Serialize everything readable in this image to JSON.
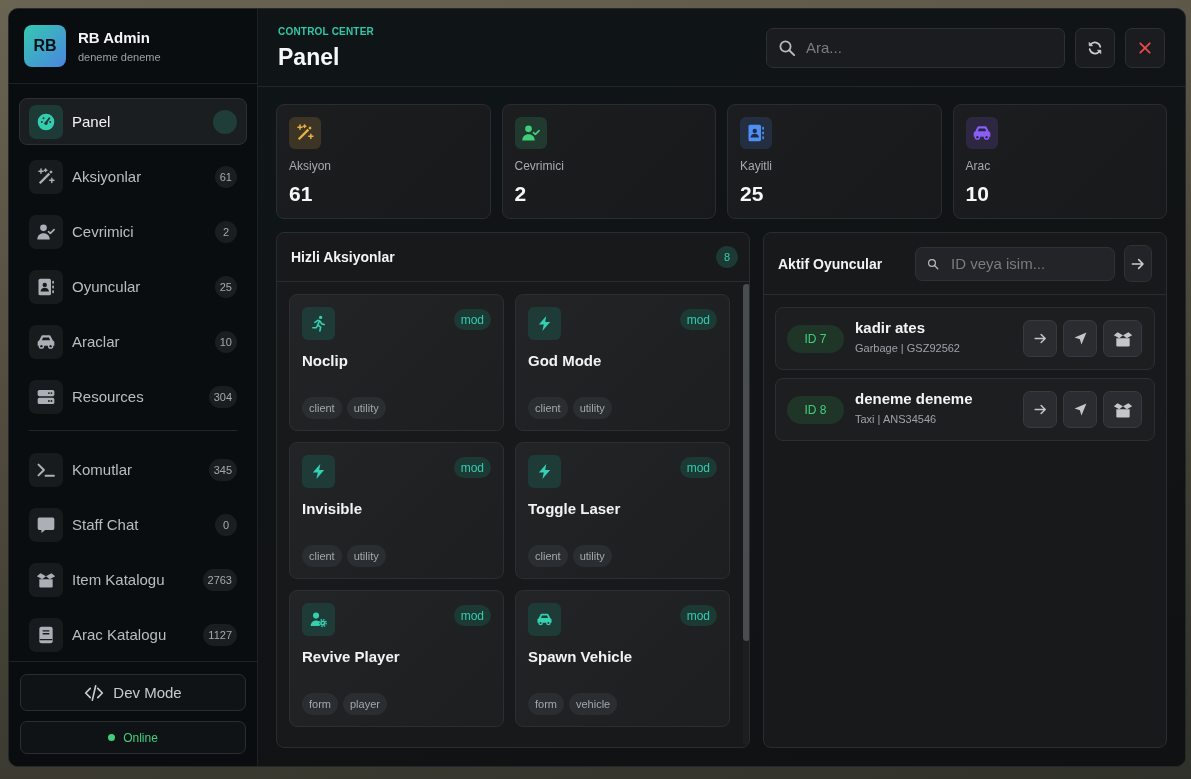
{
  "sidebar": {
    "avatar": "RB",
    "title": "RB Admin",
    "subtitle": "deneme deneme",
    "groups": [
      {
        "items": [
          {
            "label": "Panel",
            "selected": true
          },
          {
            "label": "Aksiyonlar",
            "count": "61",
            "selected": false
          },
          {
            "label": "Cevrimici",
            "count": "2",
            "selected": false
          },
          {
            "label": "Oyuncular",
            "count": "25",
            "selected": false
          },
          {
            "label": "Araclar",
            "count": "10",
            "selected": false
          },
          {
            "label": "Resources",
            "count": "304",
            "selected": false
          }
        ]
      },
      {
        "items": [
          {
            "label": "Komutlar",
            "count": "345",
            "selected": false
          },
          {
            "label": "Staff Chat",
            "count": "0",
            "selected": false
          },
          {
            "label": "Item Katalogu",
            "count": "2763",
            "selected": false
          },
          {
            "label": "Arac Katalogu",
            "count": "1127",
            "selected": false
          }
        ]
      }
    ],
    "dev_mode_button": "Dev Mode",
    "status": {
      "label": "Online",
      "online": true
    }
  },
  "header": {
    "eyebrow": "CONTROL CENTER",
    "title": "Panel",
    "search": {
      "placeholder": "Ara..."
    }
  },
  "stats": [
    {
      "label": "Aksiyon",
      "value": "61",
      "color": "#e9b145"
    },
    {
      "label": "Cevrimici",
      "value": "2",
      "color": "#3fcf7b"
    },
    {
      "label": "Kayitli",
      "value": "25",
      "color": "#4f8ef3"
    },
    {
      "label": "Arac",
      "value": "10",
      "color": "#8b5cf6"
    }
  ],
  "quick_actions": {
    "title": "Hizli Aksiyonlar",
    "count": "8",
    "actions": [
      {
        "title": "Noclip",
        "badge": "mod",
        "tags": [
          "client",
          "utility"
        ]
      },
      {
        "title": "God Mode",
        "badge": "mod",
        "tags": [
          "client",
          "utility"
        ]
      },
      {
        "title": "Invisible",
        "badge": "mod",
        "tags": [
          "client",
          "utility"
        ]
      },
      {
        "title": "Toggle Laser",
        "badge": "mod",
        "tags": [
          "client",
          "utility"
        ]
      },
      {
        "title": "Revive Player",
        "badge": "mod",
        "tags": [
          "form",
          "player"
        ]
      },
      {
        "title": "Spawn Vehicle",
        "badge": "mod",
        "tags": [
          "form",
          "vehicle"
        ]
      }
    ]
  },
  "active_players": {
    "title": "Aktif Oyuncular",
    "search": {
      "placeholder": "ID veya isim..."
    },
    "players": [
      {
        "id": "ID 7",
        "name": "kadir ates",
        "detail": "Garbage | GSZ92562"
      },
      {
        "id": "ID 8",
        "name": "deneme deneme",
        "detail": "Taxi | ANS34546"
      }
    ]
  }
}
